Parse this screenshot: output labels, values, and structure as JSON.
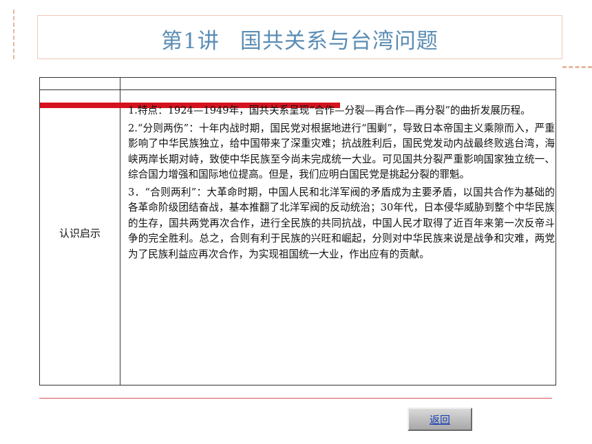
{
  "title": {
    "part1": "第1讲",
    "part2": "国共关系与台湾问题"
  },
  "table": {
    "left_label": "认识启示",
    "paragraphs": [
      "1.特点：1924—1949年，国共关系呈现“合作—分裂—再合作—再分裂”的曲折发展历程。",
      "2.“分则两伤”：十年内战时期，国民党对根据地进行“围剿”，导致日本帝国主义乘隙而入，严重影响了中华民族独立，给中国带来了深重灾难；抗战胜利后，国民党发动内战最终败逃台湾，海峡两岸长期对峙，致使中华民族至今尚未完成统一大业。可见国共分裂严重影响国家独立统一、综合国力增强和国际地位提高。但是，我们应明白国民党是挑起分裂的罪魁。",
      "3．“合则两利”：大革命时期，中国人民和北洋军阀的矛盾成为主要矛盾，以国共合作为基础的各革命阶级团结奋战，基本推翻了北洋军阀的反动统治；30年代，日本侵华威胁到整个中华民族的生存，国共两党再次合作，进行全民族的共同抗战，中国人民才取得了近百年来第一次反帝斗争的完全胜利。总之，合则有利于民族的兴旺和崛起，分则对中华民族来说是战争和灾难，两党为了民族利益应再次合作，为实现祖国统一大业，作出应有的贡献。"
    ]
  },
  "nav": {
    "return_label": "返回"
  },
  "colors": {
    "title": "#5a8db5",
    "accent_red": "#d4131e",
    "link": "#1a3fb3"
  }
}
